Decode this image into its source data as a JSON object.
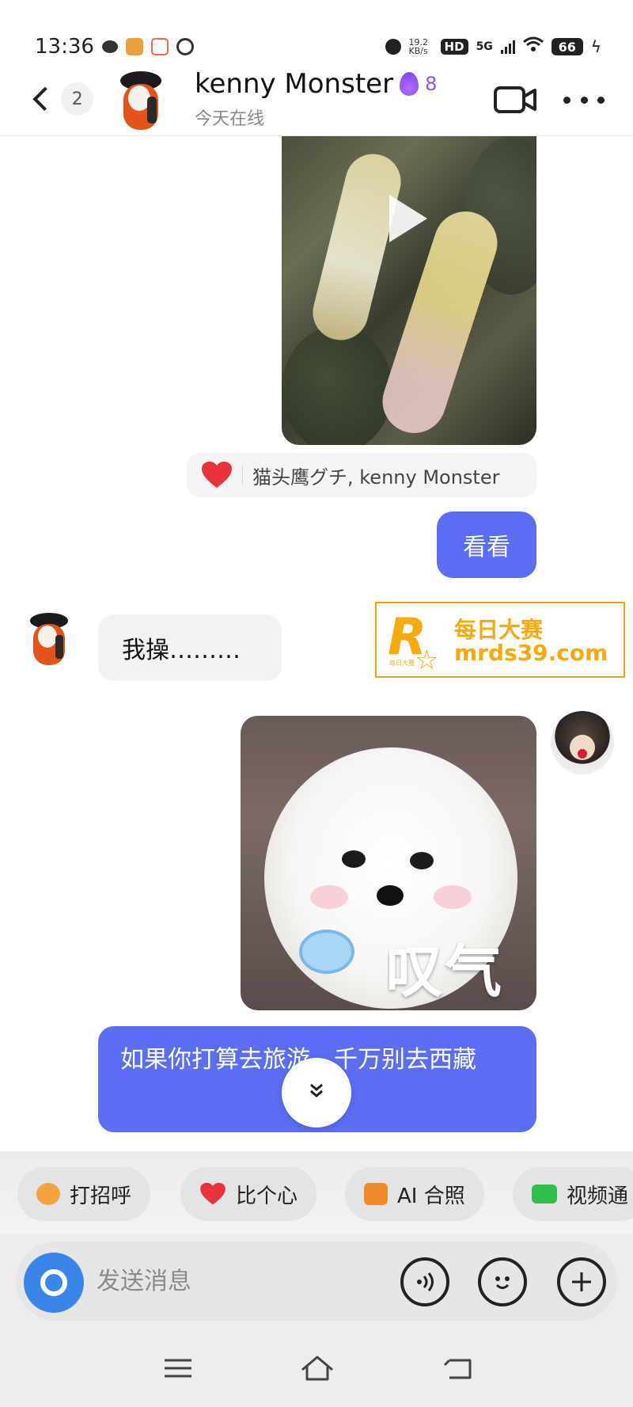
{
  "status_bar": {
    "time": "13:36",
    "network_speed": "19.2 KB/s",
    "hd_badge": "HD",
    "signal": "5G",
    "battery": "66"
  },
  "header": {
    "back_count": "2",
    "contact_name": "kenny Monster",
    "streak_count": "8",
    "online_status": "今天在线"
  },
  "messages": {
    "reaction_names": "猫头鹰グチ, kenny Monster",
    "sent_look": "看看",
    "received_wocao": "我操………",
    "sticker_caption": "叹气",
    "sent_long": "如果你打算去旅游，千万别去西藏"
  },
  "watermark": {
    "brand_cn": "每日大赛",
    "url": "mrds39.com",
    "small_text": "每日大赛"
  },
  "quick_actions": [
    {
      "label": "打招呼",
      "icon": "wave-icon",
      "color": "#f4a340"
    },
    {
      "label": "比个心",
      "icon": "heart-icon",
      "color": "#e8323c"
    },
    {
      "label": "AI 合照",
      "icon": "ai-photo-icon",
      "color": "#f08a2a"
    },
    {
      "label": "视频通",
      "icon": "video-icon",
      "color": "#2fbf4f"
    }
  ],
  "input": {
    "placeholder": "发送消息"
  },
  "colors": {
    "accent_blue": "#5b6ef3",
    "camera_blue": "#3a86e8",
    "flame_purple": "#8b54f0",
    "watermark_orange": "#f7a90d"
  }
}
